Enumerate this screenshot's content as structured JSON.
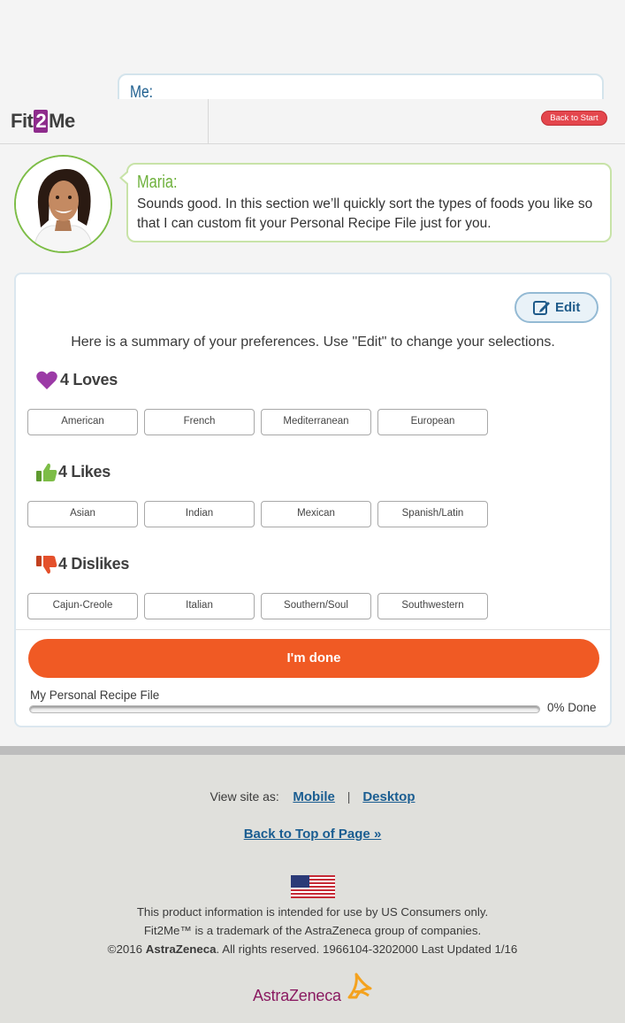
{
  "me_bubble": {
    "label": "Me:"
  },
  "header": {
    "logo": {
      "part1": "Fit",
      "part2": "2",
      "part3": "Me"
    },
    "back_to_start": "Back to Start"
  },
  "maria": {
    "name": "Maria:",
    "message": "Sounds good. In this section we’ll quickly sort the types of foods you like so that I can custom fit your Personal Recipe File just for you."
  },
  "card": {
    "edit_label": "Edit",
    "summary": "Here is a summary of your preferences. Use \"Edit\" to change your selections.",
    "sections": [
      {
        "title": "4 Loves",
        "icon": "heart-icon",
        "color": "#9b3aa6",
        "items": [
          "American",
          "French",
          "Mediterranean",
          "European"
        ]
      },
      {
        "title": "4 Likes",
        "icon": "thumbs-up-icon",
        "color": "#7dbd47",
        "items": [
          "Asian",
          "Indian",
          "Mexican",
          "Spanish/Latin"
        ]
      },
      {
        "title": "4 Dislikes",
        "icon": "thumbs-down-icon",
        "color": "#e4502b",
        "items": [
          "Cajun-Creole",
          "Italian",
          "Southern/Soul",
          "Southwestern"
        ]
      }
    ],
    "done_button": "I'm done",
    "progress": {
      "label": "My Personal Recipe File",
      "percent": 0,
      "percent_text": "0% Done"
    }
  },
  "footer": {
    "view_site_as": "View site as:",
    "mobile": "Mobile",
    "separator": "|",
    "desktop": "Desktop",
    "back_to_top": "Back to Top of Page »",
    "legal_1": "This product information is intended for use by US Consumers only.",
    "legal_2": "Fit2Me™ is a trademark of the AstraZeneca group of companies.",
    "legal_3_prefix": "©2016 ",
    "legal_3_brand": "AstraZeneca",
    "legal_3_suffix": ". All rights reserved. 1966104-3202000 Last Updated 1/16",
    "az_logo": "AstraZeneca"
  },
  "colors": {
    "accent_orange": "#f05a24",
    "brand_purple": "#8e2b8c",
    "link_blue": "#1a5d91",
    "maria_green": "#6fb13d"
  }
}
